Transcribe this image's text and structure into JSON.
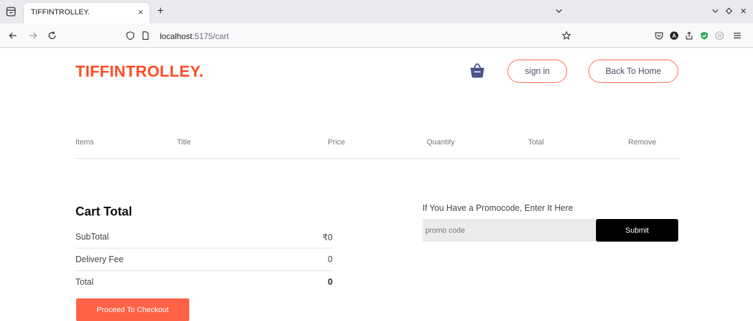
{
  "browser": {
    "tab_title": "TIFFINTROLLEY.",
    "tab_close": "×",
    "new_tab": "+",
    "url_host": "localhost",
    "url_path": ":5175/cart",
    "icons": [
      "tab-list-icon",
      "back-icon",
      "forward-icon",
      "reload-icon",
      "shield-icon",
      "page-icon",
      "bookmark-star-icon",
      "pocket-icon",
      "account-icon",
      "share-icon",
      "extension-shield-icon",
      "extension-icon",
      "menu-icon",
      "chevron-down-icon",
      "minimize-icon",
      "restore-icon",
      "close-icon"
    ]
  },
  "header": {
    "logo": "TIFFINTROLLEY.",
    "signin_label": "sign in",
    "home_label": "Back To Home"
  },
  "cart": {
    "columns": [
      "Items",
      "Title",
      "Price",
      "Quantity",
      "Total",
      "Remove"
    ]
  },
  "totals": {
    "title": "Cart Total",
    "rows": [
      {
        "label": "SubTotal",
        "value": "₹0"
      },
      {
        "label": "Delivery Fee",
        "value": "0"
      },
      {
        "label": "Total",
        "value": "0"
      }
    ],
    "checkout_label": "Proceed To Checkout"
  },
  "promo": {
    "label": "If You Have a Promocode, Enter It Here",
    "placeholder": "promo code",
    "submit_label": "Submit"
  },
  "colors": {
    "brand": "#ff4c24",
    "checkout": "#ff6347",
    "basket": "#4a5588"
  }
}
